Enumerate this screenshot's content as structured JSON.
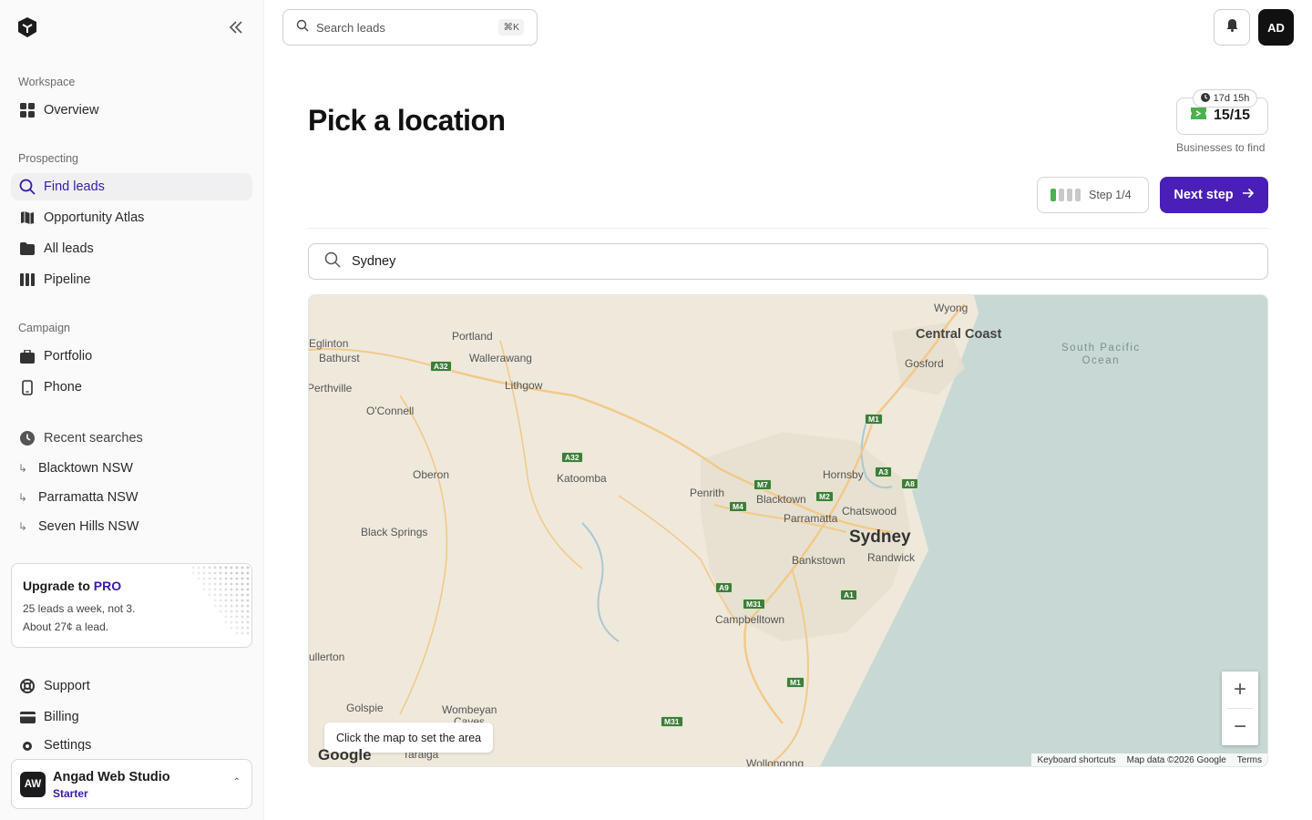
{
  "sidebar": {
    "sections": {
      "workspace": "Workspace",
      "prospecting": "Prospecting",
      "campaign": "Campaign"
    },
    "items": {
      "overview": "Overview",
      "find_leads": "Find leads",
      "opportunity_atlas": "Opportunity Atlas",
      "all_leads": "All leads",
      "pipeline": "Pipeline",
      "portfolio": "Portfolio",
      "phone": "Phone",
      "recent_searches": "Recent searches",
      "support": "Support",
      "billing": "Billing",
      "settings": "Settings"
    },
    "recent": [
      "Blacktown NSW",
      "Parramatta NSW",
      "Seven Hills NSW"
    ],
    "upgrade": {
      "title_prefix": "Upgrade to ",
      "title_pro": "PRO",
      "line1": "25 leads a week, not 3.",
      "line2": "About 27¢ a lead."
    },
    "account": {
      "initials": "AW",
      "name": "Angad Web Studio",
      "plan": "Starter"
    }
  },
  "header": {
    "search_placeholder": "Search leads",
    "search_shortcut": "⌘K",
    "user_initials": "AD"
  },
  "main": {
    "title": "Pick a location",
    "quota": {
      "timer": "17d 15h",
      "count": "15/15",
      "caption": "Businesses to find"
    },
    "step": {
      "label": "Step 1/4",
      "current": 1,
      "total": 4
    },
    "next_label": "Next step",
    "location_value": "Sydney"
  },
  "map": {
    "places": {
      "wyong": "Wyong",
      "central_coast": "Central Coast",
      "gosford": "Gosford",
      "ocean_line1": "South Pacific",
      "ocean_line2": "Ocean",
      "eglinton": "Eglinton",
      "bathurst": "Bathurst",
      "portland": "Portland",
      "wallerawang": "Wallerawang",
      "lithgow": "Lithgow",
      "perthville": "Perthville",
      "oconnell": "O'Connell",
      "oberon": "Oberon",
      "katoomba": "Katoomba",
      "hornsby": "Hornsby",
      "penrith": "Penrith",
      "blacktown": "Blacktown",
      "chatswood": "Chatswood",
      "parramatta": "Parramatta",
      "sydney": "Sydney",
      "black_springs": "Black Springs",
      "bankstown": "Bankstown",
      "randwick": "Randwick",
      "campbelltown": "Campbelltown",
      "fullerton": "ullerton",
      "golspie": "Golspie",
      "wombeyan": "Wombeyan",
      "caves": "Caves",
      "taralga": "Taralga",
      "wollongong": "Wollongong"
    },
    "shields": {
      "a32a": "A32",
      "a32b": "A32",
      "m1a": "M1",
      "a3": "A3",
      "a8": "A8",
      "m7": "M7",
      "m2": "M2",
      "m4": "M4",
      "a9": "A9",
      "m31a": "M31",
      "a1": "A1",
      "m1b": "M1",
      "m31b": "M31"
    },
    "hint": "Click the map to set the area",
    "zoom_in": "+",
    "zoom_out": "−",
    "google": "Google",
    "attribution": {
      "shortcuts": "Keyboard shortcuts",
      "data": "Map data ©2026 Google",
      "terms": "Terms"
    },
    "colors": {
      "land": "#efe9dc",
      "water": "#c8d9d5",
      "urban": "#e5dfcf",
      "road": "#f3c98a",
      "forest": "#e2e5cf"
    }
  }
}
